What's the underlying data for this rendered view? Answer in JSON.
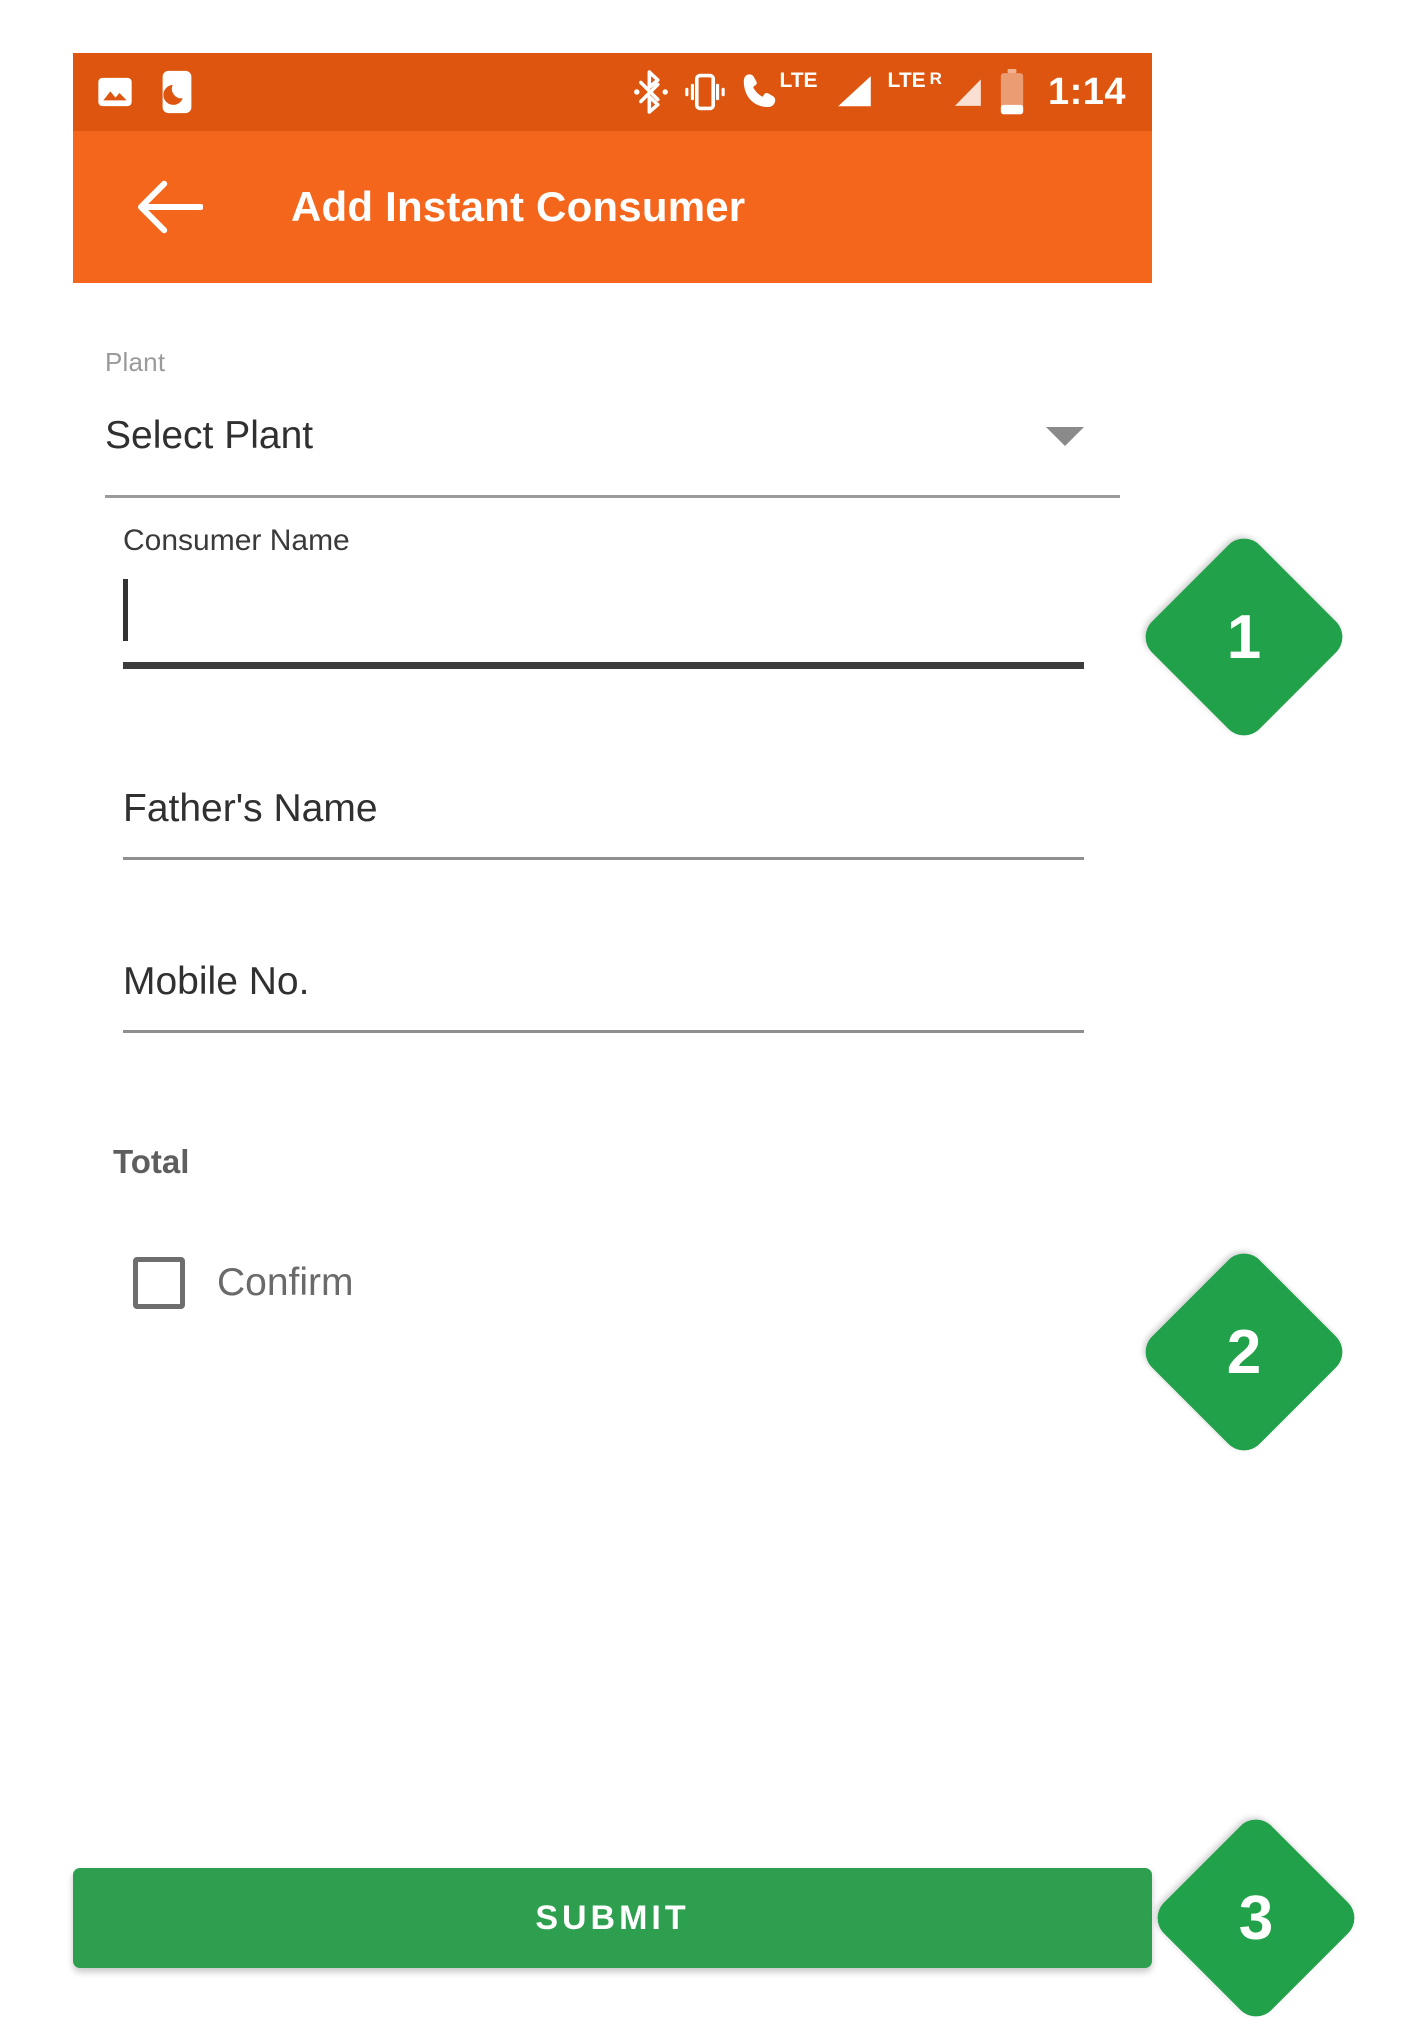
{
  "status_bar": {
    "background_color": "#DD550F",
    "icons": [
      "image-icon",
      "moon-icon",
      "bluetooth-icon",
      "vibrate-icon",
      "volte-call-icon",
      "signal-icon",
      "signal-roaming-icon",
      "battery-icon"
    ],
    "lte_primary": "LTE",
    "lte_secondary": "LTE",
    "roaming": "R",
    "clock": "1:14"
  },
  "app_bar": {
    "background_color": "#F4661C",
    "back_icon": "arrow-left-icon",
    "title": "Add Instant Consumer"
  },
  "form": {
    "plant": {
      "label": "Plant",
      "value": "Select Plant",
      "caret_icon": "chevron-down-icon"
    },
    "consumer_name": {
      "label": "Consumer Name",
      "value": "",
      "focused": true
    },
    "fathers_name": {
      "placeholder": "Father's Name",
      "value": ""
    },
    "mobile_no": {
      "placeholder": "Mobile No.",
      "value": ""
    },
    "total": {
      "label": "Total",
      "value": ""
    },
    "confirm": {
      "label": "Confirm",
      "checked": false
    }
  },
  "submit": {
    "label": "SUBMIT",
    "color": "#2E9E4F"
  },
  "badges": {
    "color": "#21A24A",
    "items": [
      {
        "number": "1"
      },
      {
        "number": "2"
      },
      {
        "number": "3"
      }
    ]
  }
}
